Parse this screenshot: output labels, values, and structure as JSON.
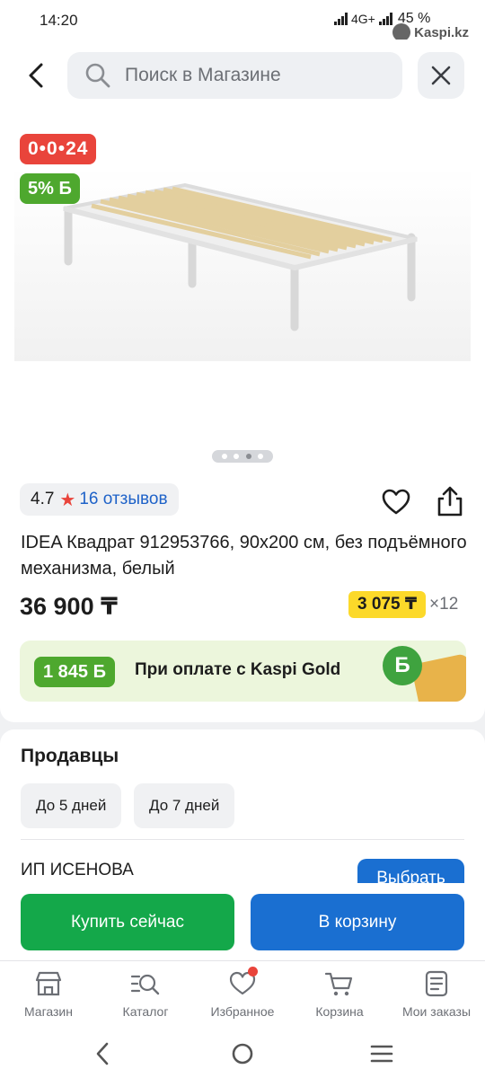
{
  "status_bar": {
    "time": "14:20",
    "network": "4G+",
    "battery": "45 %",
    "watermark": "Kaspi.kz"
  },
  "search": {
    "placeholder": "Поиск в Магазине",
    "back_icon": "chevron-left-icon",
    "clear_icon": "close-icon"
  },
  "product": {
    "timer_badge": "0•0•24",
    "bonus_badge": "5% Б",
    "gallery": {
      "total_images": 4,
      "active_index": 2
    },
    "rating": "4.7",
    "reviews": "16 отзывов",
    "title": "IDEA Квадрат 912953766, 90х200 см, без подъёмного механизма, белый",
    "price": "36 900 ₸",
    "installment_amount": "3 075 ₸",
    "installment_months": "×12",
    "kaspi_gold": {
      "bonus": "1 845 Б",
      "text": "При оплате с Kaspi Gold",
      "coin_label": "Б"
    }
  },
  "sellers": {
    "title": "Продавцы",
    "filters": [
      "До 5 дней",
      "До 7 дней"
    ],
    "first_seller": "ИП ИСЕНОВА",
    "select_label": "Выбрать"
  },
  "actions": {
    "buy_now": "Купить сейчас",
    "add_to_cart": "В корзину"
  },
  "tabbar": [
    {
      "label": "Магазин",
      "icon": "store-icon"
    },
    {
      "label": "Каталог",
      "icon": "catalog-search-icon"
    },
    {
      "label": "Избранное",
      "icon": "heart-icon",
      "has_dot": true
    },
    {
      "label": "Корзина",
      "icon": "cart-icon"
    },
    {
      "label": "Мои заказы",
      "icon": "orders-icon"
    }
  ],
  "colors": {
    "brand_red": "#e9443b",
    "bonus_green": "#4ea82e",
    "buy_green": "#14a84a",
    "cart_blue": "#1a6fd1",
    "installment_yellow": "#fcd92a"
  }
}
